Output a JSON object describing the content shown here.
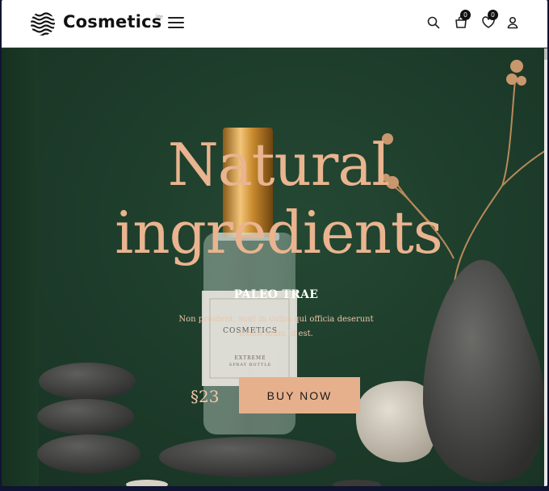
{
  "header": {
    "brand": "Cosmetics",
    "brand_superscript": "lite",
    "cart_count": "0",
    "wishlist_count": "0"
  },
  "hero": {
    "title_line1": "Natural",
    "title_line2": "ingredients",
    "subheading": "PALEO TRAE",
    "description_line1": "Non proident, sunt in culpa qui officia deserunt",
    "description_line2": "mollit anim id est.",
    "price": "§23",
    "cta_label": "BUY NOW",
    "bottle_label_brand": "COSMETICS",
    "bottle_label_line1": "EXTREME",
    "bottle_label_line2": "SPRAY BOTTLE"
  },
  "colors": {
    "accent": "#e7b08c",
    "hero_bg": "#1d3b2a",
    "title": "#e9b48f"
  },
  "icons": [
    "logo-waves-icon",
    "menu-icon",
    "search-icon",
    "cart-icon",
    "heart-icon",
    "user-icon"
  ]
}
